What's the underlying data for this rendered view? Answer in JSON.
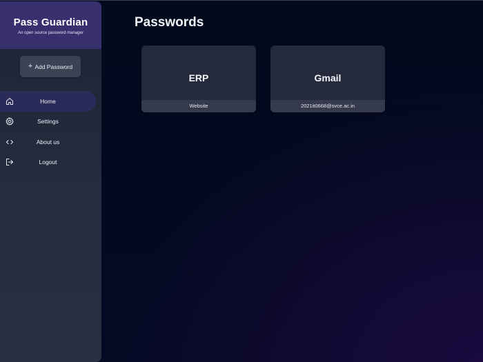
{
  "brand": {
    "title": "Pass Guardian",
    "subtitle": "An open source password manager"
  },
  "sidebar": {
    "add_button": {
      "plus": "+",
      "label": "Add Password"
    },
    "items": [
      {
        "label": "Home",
        "icon": "home-icon",
        "active": true
      },
      {
        "label": "Settings",
        "icon": "gear-icon",
        "active": false
      },
      {
        "label": "About us",
        "icon": "code-icon",
        "active": false
      },
      {
        "label": "Logout",
        "icon": "logout-icon",
        "active": false
      }
    ]
  },
  "main": {
    "title": "Passwords",
    "cards": [
      {
        "name": "ERP",
        "detail": "Website"
      },
      {
        "name": "Gmail",
        "detail": "2021it0668@svce.ac.in"
      }
    ]
  },
  "colors": {
    "brand_header": "#372f6e",
    "active_nav": "#2a2b58",
    "card": "#242a3b",
    "card_footer": "#353b4c"
  }
}
